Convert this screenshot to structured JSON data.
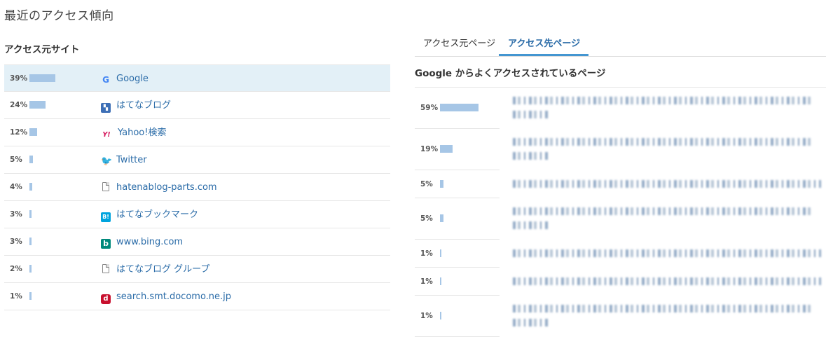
{
  "page_title": "最近のアクセス傾向",
  "left": {
    "heading": "アクセス元サイト",
    "rows": [
      {
        "percent": "39%",
        "value": 39,
        "site": "Google",
        "icon": "google-icon"
      },
      {
        "percent": "24%",
        "value": 24,
        "site": "はてなブログ",
        "icon": "hatena-blog-icon"
      },
      {
        "percent": "12%",
        "value": 12,
        "site": "Yahoo!検索",
        "icon": "yahoo-icon"
      },
      {
        "percent": "5%",
        "value": 5,
        "site": "Twitter",
        "icon": "twitter-icon"
      },
      {
        "percent": "4%",
        "value": 4,
        "site": "hatenablog-parts.com",
        "icon": "page-icon"
      },
      {
        "percent": "3%",
        "value": 3,
        "site": "はてなブックマーク",
        "icon": "hatena-bookmark-icon"
      },
      {
        "percent": "3%",
        "value": 3,
        "site": "www.bing.com",
        "icon": "bing-icon"
      },
      {
        "percent": "2%",
        "value": 2,
        "site": "はてなブログ グループ",
        "icon": "page-icon"
      },
      {
        "percent": "1%",
        "value": 1,
        "site": "search.smt.docomo.ne.jp",
        "icon": "docomo-icon"
      }
    ]
  },
  "right": {
    "tabs": [
      {
        "label": "アクセス元ページ",
        "active": false
      },
      {
        "label": "アクセス先ページ",
        "active": true
      }
    ],
    "heading": "Google からよくアクセスされているページ",
    "rows": [
      {
        "percent": "59%",
        "value": 59,
        "lines": 2
      },
      {
        "percent": "19%",
        "value": 19,
        "lines": 2
      },
      {
        "percent": "5%",
        "value": 5,
        "lines": 1
      },
      {
        "percent": "5%",
        "value": 5,
        "lines": 2
      },
      {
        "percent": "1%",
        "value": 1,
        "lines": 1
      },
      {
        "percent": "1%",
        "value": 1,
        "lines": 1
      },
      {
        "percent": "1%",
        "value": 1,
        "lines": 2
      }
    ]
  },
  "colors": {
    "bar": "#a6c6e6",
    "link": "#2b6ca8",
    "highlight_row": "#e3f0f7",
    "active_tab_underline": "#4496d1"
  }
}
